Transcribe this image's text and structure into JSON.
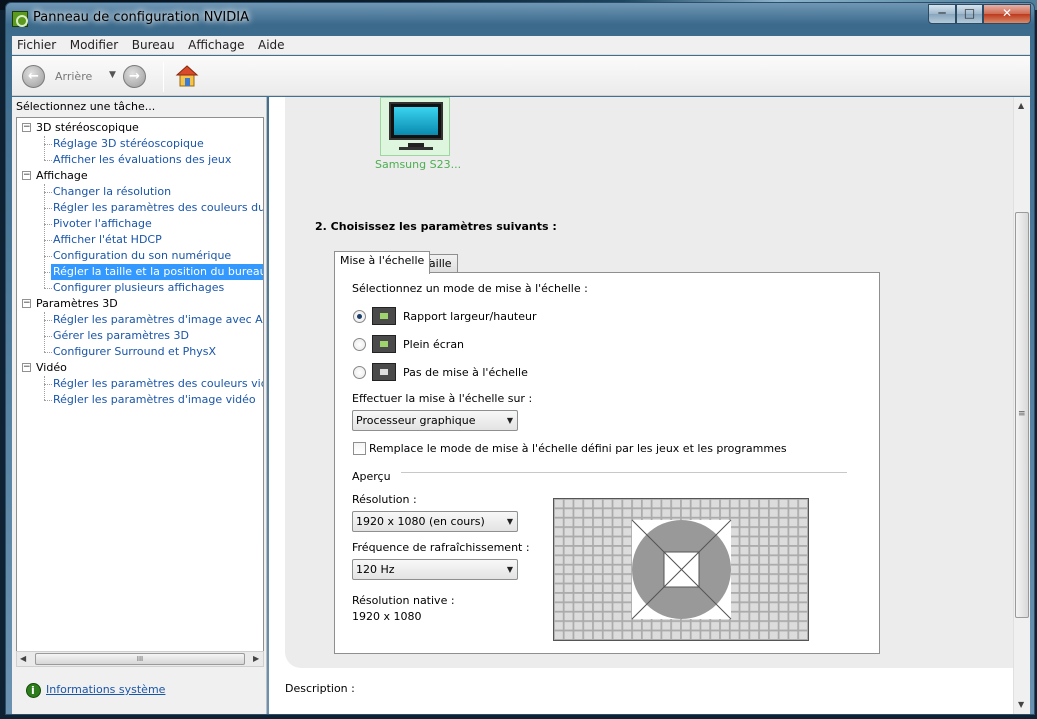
{
  "window": {
    "title": "Panneau de configuration NVIDIA",
    "buttons": {
      "minimize": "─",
      "maximize": "□",
      "close": "✕"
    }
  },
  "menu": [
    "Fichier",
    "Modifier",
    "Bureau",
    "Affichage",
    "Aide"
  ],
  "toolbar": {
    "back_label": "Arrière"
  },
  "left_pane": {
    "header": "Sélectionnez une tâche...",
    "tree": [
      {
        "label": "3D stéréoscopique",
        "children": [
          "Réglage 3D stéréoscopique",
          "Afficher les évaluations des jeux"
        ]
      },
      {
        "label": "Affichage",
        "children": [
          "Changer la résolution",
          "Régler les paramètres des couleurs du bure",
          "Pivoter l'affichage",
          "Afficher l'état HDCP",
          "Configuration du son numérique",
          "Régler la taille et la position du bureau",
          "Configurer plusieurs affichages"
        ]
      },
      {
        "label": "Paramètres 3D",
        "children": [
          "Régler les paramètres d'image avec Aperçu",
          "Gérer les paramètres 3D",
          "Configurer Surround et PhysX"
        ]
      },
      {
        "label": "Vidéo",
        "children": [
          "Régler les paramètres des couleurs vidéo",
          "Régler les paramètres d'image vidéo"
        ]
      }
    ],
    "selected": "Régler la taille et la position du bureau",
    "hscroll_grip": "III",
    "system_info_link": "Informations système"
  },
  "main": {
    "monitor_label": "Samsung S23...",
    "step2_title": "2. Choisissez les paramètres suivants :",
    "tabs": [
      "Mise à l'échelle",
      "Taille"
    ],
    "active_tab": "Mise à l'échelle",
    "scaling_mode_label": "Sélectionnez un mode de mise à l'échelle :",
    "scaling_modes": [
      {
        "label": "Rapport largeur/hauteur",
        "selected": true
      },
      {
        "label": "Plein écran",
        "selected": false
      },
      {
        "label": "Pas de mise à l'échelle",
        "selected": false
      }
    ],
    "perform_on_label": "Effectuer la mise à l'échelle sur :",
    "perform_on_value": "Processeur graphique",
    "override_checkbox": {
      "label": "Remplace le mode de mise à l'échelle défini par les jeux et les programmes",
      "checked": false
    },
    "preview_group": "Aperçu",
    "resolution_label": "Résolution :",
    "resolution_value": "1920 x 1080 (en cours)",
    "refresh_label": "Fréquence de rafraîchissement :",
    "refresh_value": "120 Hz",
    "native_label": "Résolution native :",
    "native_value": "1920 x 1080",
    "description_label": "Description :"
  },
  "colors": {
    "link": "#1a56a8",
    "selection": "#3399ff",
    "monitor_label": "#4caf50",
    "panel_bg": "#ececec"
  }
}
